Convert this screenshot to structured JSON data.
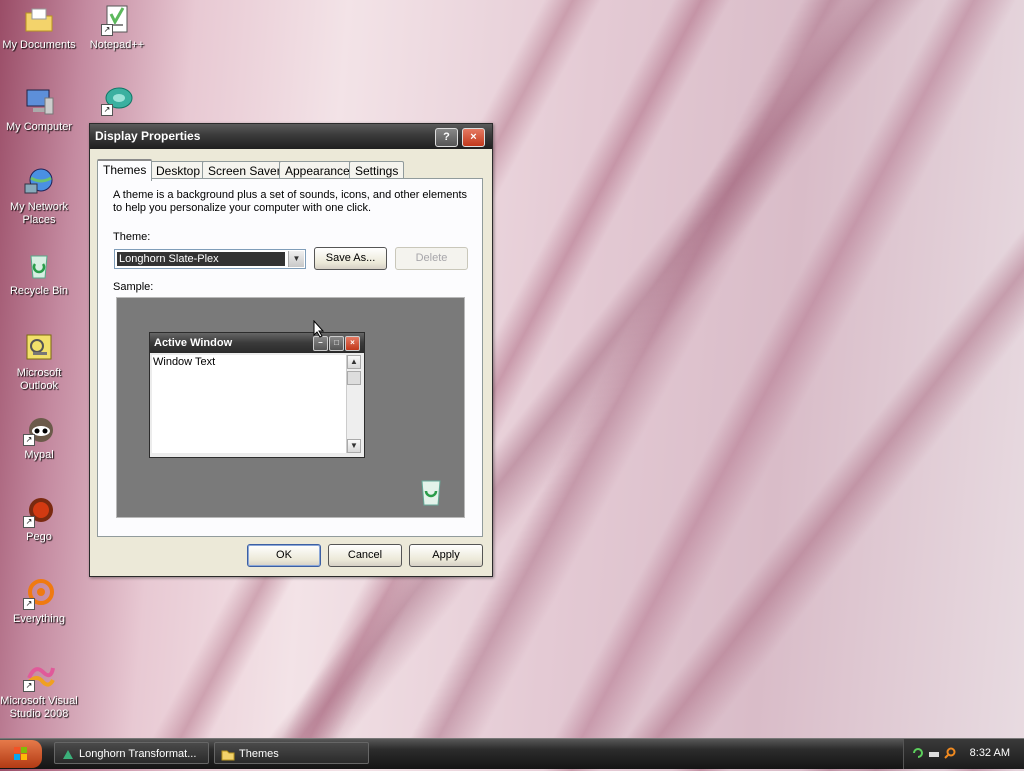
{
  "desktop": {
    "icons": [
      {
        "label": "My Documents",
        "icon": "folder-icon"
      },
      {
        "label": "Notepad++",
        "icon": "notepad-icon"
      },
      {
        "label": "My Computer",
        "icon": "computer-icon"
      },
      {
        "label": "My Network Places",
        "icon": "network-icon"
      },
      {
        "label": "Recycle Bin",
        "icon": "recycle-bin-icon"
      },
      {
        "label": "Microsoft Outlook",
        "icon": "outlook-icon"
      },
      {
        "label": "Mypal",
        "icon": "mypal-icon"
      },
      {
        "label": "Pego",
        "icon": "pego-icon"
      },
      {
        "label": "Everything",
        "icon": "everything-icon"
      },
      {
        "label": "Microsoft Visual Studio 2008",
        "icon": "visual-studio-icon"
      }
    ]
  },
  "dialog": {
    "title": "Display Properties",
    "help_label": "?",
    "close_label": "×",
    "tabs": [
      "Themes",
      "Desktop",
      "Screen Saver",
      "Appearance",
      "Settings"
    ],
    "description": "A theme is a background plus a set of sounds, icons, and other elements to help you personalize your computer with one click.",
    "theme_label": "Theme:",
    "theme_value": "Longhorn Slate-Plex",
    "save_as_label": "Save As...",
    "delete_label": "Delete",
    "sample_label": "Sample:",
    "sample_window": {
      "title": "Active Window",
      "body_text": "Window Text"
    },
    "ok_label": "OK",
    "cancel_label": "Cancel",
    "apply_label": "Apply"
  },
  "taskbar": {
    "tasks": [
      {
        "label": "Longhorn Transformat...",
        "icon": "longhorn-icon"
      },
      {
        "label": "Themes",
        "icon": "folder-icon"
      }
    ],
    "clock": "8:32 AM"
  }
}
